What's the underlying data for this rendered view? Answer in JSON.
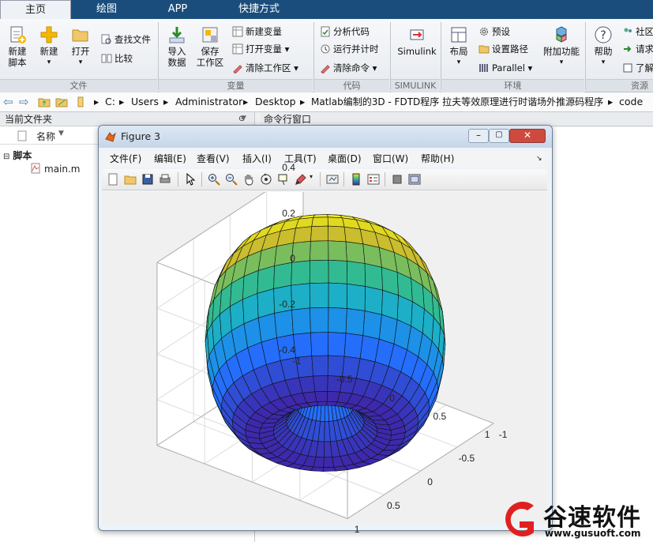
{
  "tabs": [
    {
      "label": "主页",
      "active": true
    },
    {
      "label": "绘图",
      "active": false
    },
    {
      "label": "APP",
      "active": false
    },
    {
      "label": "快捷方式",
      "active": false
    }
  ],
  "ribbon": {
    "file_group": {
      "new_script": "新建\n脚本",
      "new": "新建",
      "open": "打开",
      "find_files": "查找文件",
      "compare": "比较",
      "label": "文件"
    },
    "variable_group": {
      "import_data": "导入\n数据",
      "save_workspace": "保存\n工作区",
      "new_variable": "新建变量",
      "open_variable": "打开变量",
      "clear_workspace": "清除工作区",
      "label": "变量"
    },
    "code_group": {
      "analyze_code": "分析代码",
      "run_and_time": "运行并计时",
      "clear_commands": "清除命令",
      "label": "代码"
    },
    "simulink_group": {
      "simulink": "Simulink",
      "label": "SIMULINK"
    },
    "env_group": {
      "layout": "布局",
      "preferences": "预设",
      "set_path": "设置路径",
      "parallel": "Parallel",
      "addons": "附加功能",
      "label": "环境"
    },
    "help_group": {
      "help": "帮助",
      "label": ""
    },
    "resources_group": {
      "community": "社区",
      "request": "请求",
      "learn": "了解",
      "label": "资源"
    }
  },
  "address": {
    "segments": [
      "C:",
      "Users",
      "Administrator",
      "Desktop",
      "Matlab编制的3D - FDTD程序 拉夫等效原理进行时谐场外推源码程序",
      "code"
    ]
  },
  "current_folder": {
    "title": "当前文件夹",
    "column_name": "名称",
    "group_label": "脚本",
    "files": [
      "main.m"
    ]
  },
  "command_window": {
    "title": "命令行窗口"
  },
  "figure": {
    "title": "Figure 3",
    "menu": [
      "文件(F)",
      "编辑(E)",
      "查看(V)",
      "插入(I)",
      "工具(T)",
      "桌面(D)",
      "窗口(W)",
      "帮助(H)"
    ]
  },
  "chart_data": {
    "type": "surface",
    "surface": "torus",
    "grid": true,
    "colormap": "parula",
    "z_ticks": [
      "0.4",
      "0.2",
      "0",
      "-0.2",
      "-0.4"
    ],
    "x_ticks": [
      "1",
      "0.5",
      "0",
      "-0.5",
      "-1"
    ],
    "y_ticks": [
      "-1",
      "-0.5",
      "0",
      "0.5",
      "1"
    ],
    "xlim": [
      -1,
      1
    ],
    "ylim": [
      -1,
      1
    ],
    "zlim": [
      -0.4,
      0.4
    ],
    "title": "",
    "xlabel": "",
    "ylabel": "",
    "zlabel": ""
  },
  "watermark": {
    "text": "谷速软件",
    "url": "www.gusuoft.com"
  },
  "colors": {
    "tabbar": "#1a4d7c",
    "watermark_red": "#e02020"
  }
}
